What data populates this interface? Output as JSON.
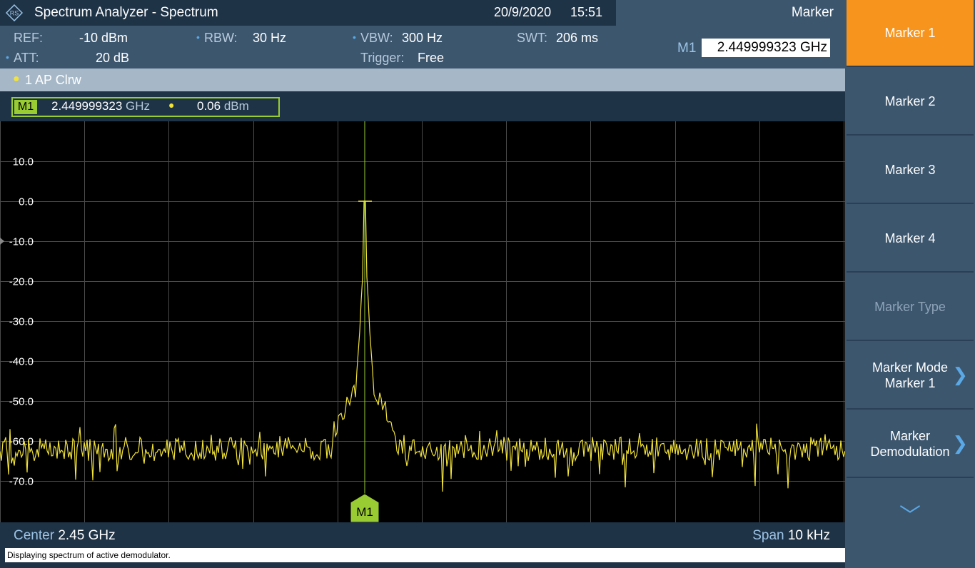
{
  "header": {
    "title": "Spectrum Analyzer - Spectrum",
    "date": "20/9/2020",
    "time": "15:51"
  },
  "params": {
    "ref_label": "REF:",
    "ref_value": "-10 dBm",
    "att_label": "ATT:",
    "att_value": "20 dB",
    "rbw_label": "RBW:",
    "rbw_value": "30 Hz",
    "vbw_label": "VBW:",
    "vbw_value": "300 Hz",
    "trigger_label": "Trigger:",
    "trigger_value": "Free",
    "swt_label": "SWT:",
    "swt_value": "206 ms"
  },
  "marker_panel": {
    "title": "Marker",
    "m1_label": "M1",
    "m1_value": "2.449999323 GHz"
  },
  "trace": {
    "label": "1 AP  Clrw"
  },
  "marker_readout": {
    "tag": "M1",
    "freq": "2.449999323",
    "freq_unit": "GHz",
    "level": "0.06",
    "level_unit": "dBm"
  },
  "plot": {
    "y_ticks": [
      "10.0",
      "0.0",
      "-10.0",
      "-20.0",
      "-30.0",
      "-40.0",
      "-50.0",
      "-60.0",
      "-70.0"
    ],
    "marker_label": "M1",
    "colors": {
      "trace": "#f2e33a",
      "marker": "#99cc33",
      "grid": "#4a4a4a"
    }
  },
  "footer": {
    "center_label": "Center",
    "center_value": "2.45 GHz",
    "span_label": "Span",
    "span_value": "10 kHz"
  },
  "status": {
    "text": "Displaying spectrum of active demodulator."
  },
  "softkeys": [
    {
      "label": "Marker 1",
      "state": "active"
    },
    {
      "label": "Marker 2",
      "state": "normal"
    },
    {
      "label": "Marker 3",
      "state": "normal"
    },
    {
      "label": "Marker 4",
      "state": "normal"
    },
    {
      "label": "Marker Type",
      "state": "disabled"
    },
    {
      "label": "Marker Mode",
      "label2": "Marker 1",
      "state": "normal"
    },
    {
      "label": "Marker",
      "label2": "Demodulation",
      "state": "normal"
    }
  ],
  "icons": {
    "chevron": "chevron-right-icon",
    "more": "chevron-down-icon",
    "logo": "rs-logo-icon"
  }
}
